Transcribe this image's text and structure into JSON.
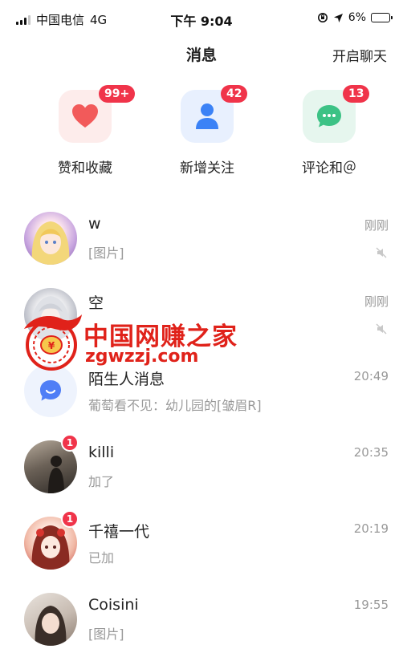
{
  "status_bar": {
    "carrier": "中国电信",
    "network": "4G",
    "time": "下午 9:04",
    "battery": "6%",
    "battery_level": 0.06
  },
  "header": {
    "title": "消息",
    "action_label": "开启聊天"
  },
  "quick_actions": [
    {
      "label": "赞和收藏",
      "badge": "99+",
      "icon": "heart-icon",
      "tile_color": "#fdeceb",
      "icon_color": "#f25a5a"
    },
    {
      "label": "新增关注",
      "badge": "42",
      "icon": "user-icon",
      "tile_color": "#e8f0fe",
      "icon_color": "#3b82f6"
    },
    {
      "label": "评论和＠",
      "badge": "13",
      "icon": "chat-bubble-icon",
      "tile_color": "#e6f6ee",
      "icon_color": "#3cc285"
    }
  ],
  "messages": [
    {
      "name": "w",
      "preview": "[图片]",
      "time": "刚刚",
      "muted": true,
      "badge": null,
      "avatar": "anime-girl-avatar"
    },
    {
      "name": "空",
      "preview": "",
      "time": "刚刚",
      "muted": true,
      "badge": null,
      "avatar": "anime-silver-hair-avatar"
    },
    {
      "name": "陌生人消息",
      "preview": "葡萄看不见：幼儿园的[皱眉R]",
      "time": "20:49",
      "muted": false,
      "badge": null,
      "avatar": "stranger-chat-icon"
    },
    {
      "name": "killi",
      "preview": "加了",
      "time": "20:35",
      "muted": false,
      "badge": "1",
      "avatar": "photo-avatar-dark"
    },
    {
      "name": "千禧一代",
      "preview": "已加",
      "time": "20:19",
      "muted": false,
      "badge": "1",
      "avatar": "anime-red-avatar"
    },
    {
      "name": "Coisini",
      "preview": "[图片]",
      "time": "19:55",
      "muted": false,
      "badge": null,
      "avatar": "photo-avatar-girl"
    }
  ],
  "watermark": {
    "title": "中国网赚之家",
    "site": "zgwzzj.com",
    "color": "#e0221a"
  },
  "colors": {
    "badge": "#f0344a",
    "muted_text": "#999999"
  }
}
